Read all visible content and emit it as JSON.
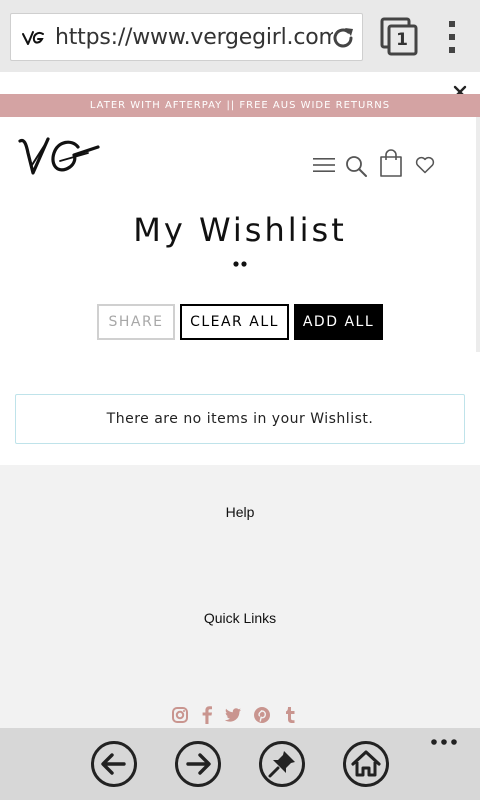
{
  "browser": {
    "url": "https://www.vergegirl.com/a/wishlist",
    "tab_count": "1",
    "icons": {
      "reload": "reload-icon",
      "tabs": "tabs-icon",
      "menu": "vertical-dots-icon",
      "back": "back-arrow-icon",
      "forward": "forward-arrow-icon",
      "pin": "pin-icon",
      "home": "home-icon",
      "more": "horizontal-dots-icon"
    }
  },
  "promo": {
    "text": "LATER WITH AFTERPAY || FREE AUS WIDE RETURNS",
    "background": "#d4a3a3"
  },
  "header": {
    "logo_text": "VG",
    "icons": [
      "hamburger-menu-icon",
      "search-icon",
      "shopping-bag-icon",
      "heart-icon"
    ]
  },
  "wishlist": {
    "title": "My Wishlist",
    "share_label": "SHARE",
    "clear_all_label": "CLEAR ALL",
    "add_all_label": "ADD ALL",
    "empty_message": "There are no items in your Wishlist."
  },
  "footer": {
    "help_label": "Help",
    "quick_links_label": "Quick Links",
    "social_color": "#c9958f",
    "social_icons": [
      "instagram-icon",
      "facebook-icon",
      "twitter-icon",
      "pinterest-icon",
      "tumblr-icon"
    ]
  }
}
